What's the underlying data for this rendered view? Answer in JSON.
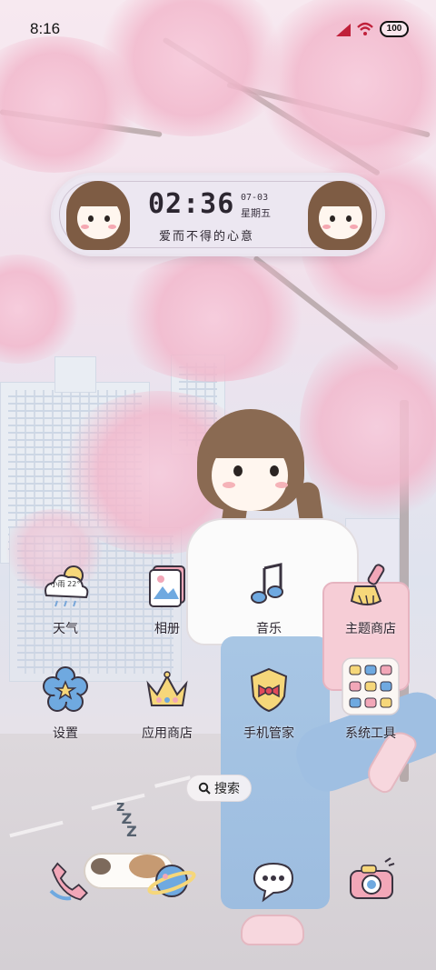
{
  "status_bar": {
    "time": "8:16",
    "battery": "100"
  },
  "clock_widget": {
    "time": "02:36",
    "date": "07-03",
    "weekday": "星期五",
    "motto": "爱而不得的心意"
  },
  "apps": [
    {
      "id": "weather",
      "label": "天气",
      "badge_text": "小雨 22°",
      "icon": "weather-cloud-icon"
    },
    {
      "id": "gallery",
      "label": "相册",
      "icon": "photo-album-icon"
    },
    {
      "id": "music",
      "label": "音乐",
      "icon": "music-note-icon"
    },
    {
      "id": "themes",
      "label": "主题商店",
      "icon": "paint-brush-icon"
    },
    {
      "id": "settings",
      "label": "设置",
      "icon": "flower-gear-icon"
    },
    {
      "id": "appstore",
      "label": "应用商店",
      "icon": "crown-icon"
    },
    {
      "id": "phone-manager",
      "label": "手机管家",
      "icon": "shield-bow-icon"
    },
    {
      "id": "system-tools",
      "label": "系统工具",
      "icon": "folder-grid-icon"
    }
  ],
  "search": {
    "label": "搜索"
  },
  "dock": [
    {
      "id": "phone",
      "icon": "phone-icon"
    },
    {
      "id": "browser",
      "icon": "planet-icon"
    },
    {
      "id": "messages",
      "icon": "chat-bubble-icon"
    },
    {
      "id": "camera",
      "icon": "camera-icon"
    }
  ],
  "colors": {
    "blossom": "#f2b8cc",
    "sky": "#dfe3ee",
    "text": "#2c2630"
  }
}
